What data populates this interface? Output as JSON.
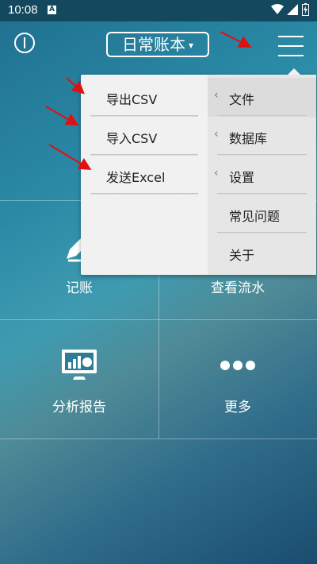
{
  "status": {
    "time": "10:08",
    "notif_icon": "A"
  },
  "header": {
    "book": "日常账本",
    "caret": "▾"
  },
  "tiles": [
    {
      "label": "记账"
    },
    {
      "label": "查看流水"
    },
    {
      "label": "分析报告"
    },
    {
      "label": "更多"
    }
  ],
  "popup": {
    "left_items": [
      "导出CSV",
      "导入CSV",
      "发送Excel"
    ],
    "right_items": [
      {
        "label": "文件",
        "submenu": true
      },
      {
        "label": "数据库",
        "submenu": true
      },
      {
        "label": "设置",
        "submenu": true
      },
      {
        "label": "常见问题",
        "submenu": false
      },
      {
        "label": "关于",
        "submenu": false
      }
    ],
    "chevron": "‹"
  },
  "colors": {
    "accent": "#1f6f8f",
    "annotation_arrow": "#e01010"
  }
}
